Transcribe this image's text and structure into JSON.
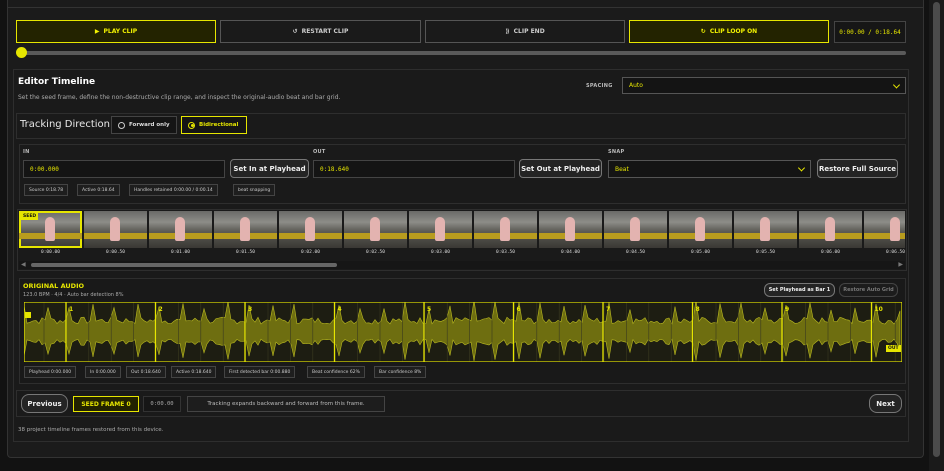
{
  "transport": {
    "play_label": "PLAY CLIP",
    "restart_label": "RESTART CLIP",
    "clip_end_label": "CLIP END",
    "loop_label": "CLIP LOOP ON",
    "time_display": "0:00.00 / 0:18.64",
    "scrub_position": 0
  },
  "editor": {
    "title": "Editor Timeline",
    "subtitle": "Set the seed frame, define the non-destructive clip range, and inspect the original-audio beat and bar grid.",
    "spacing_label": "SPACING",
    "spacing_value": "Auto"
  },
  "tracking": {
    "label": "Tracking Direction",
    "option_forward": "Forward only",
    "option_bidirectional": "Bidirectional",
    "selected": "Bidirectional"
  },
  "range": {
    "in_label": "IN",
    "in_value": "0:00.000",
    "set_in_label": "Set In at Playhead",
    "out_label": "OUT",
    "out_value": "0:18.640",
    "set_out_label": "Set Out at Playhead",
    "snap_label": "SNAP",
    "snap_value": "Beat",
    "restore_label": "Restore Full Source",
    "chips": [
      "Source 0:18.78",
      "Active 0:18.64",
      "Handles retained 0:00.00 / 0:00.14",
      "beat snapping"
    ]
  },
  "filmstrip": {
    "seed_tag": "SEED",
    "frames": [
      "0:00.00",
      "0:00.50",
      "0:01.00",
      "0:01.50",
      "0:02.00",
      "0:02.50",
      "0:03.00",
      "0:03.50",
      "0:04.00",
      "0:04.50",
      "0:05.00",
      "0:05.50",
      "0:06.00",
      "0:06.50"
    ]
  },
  "audio": {
    "title": "ORIGINAL AUDIO",
    "detail": "123.0 BPM · 4/4 · Auto bar detection 8%",
    "set_bar1_label": "Set Playhead as Bar 1",
    "restore_grid_label": "Restore Auto Grid",
    "bars": [
      "1",
      "2",
      "3",
      "4",
      "5",
      "6",
      "7",
      "8",
      "9",
      "10"
    ],
    "out_tag": "OUT",
    "chips": [
      "Playhead 0:00.000",
      "In 0:00.000",
      "Out 0:18.640",
      "Active 0:18.640",
      "First detected bar 0:00.880",
      "Beat confidence 62%",
      "Bar confidence 8%"
    ]
  },
  "footer": {
    "previous_label": "Previous",
    "seed_frame_label": "SEED FRAME 0",
    "seed_time": "0:00.00",
    "hint": "Tracking expands backward and forward from this frame.",
    "next_label": "Next",
    "restored_note": "38 project timeline frames restored from this device."
  },
  "colors": {
    "accent": "#e6e600",
    "background": "#1a1a1a",
    "wave": "#8a8a14"
  }
}
